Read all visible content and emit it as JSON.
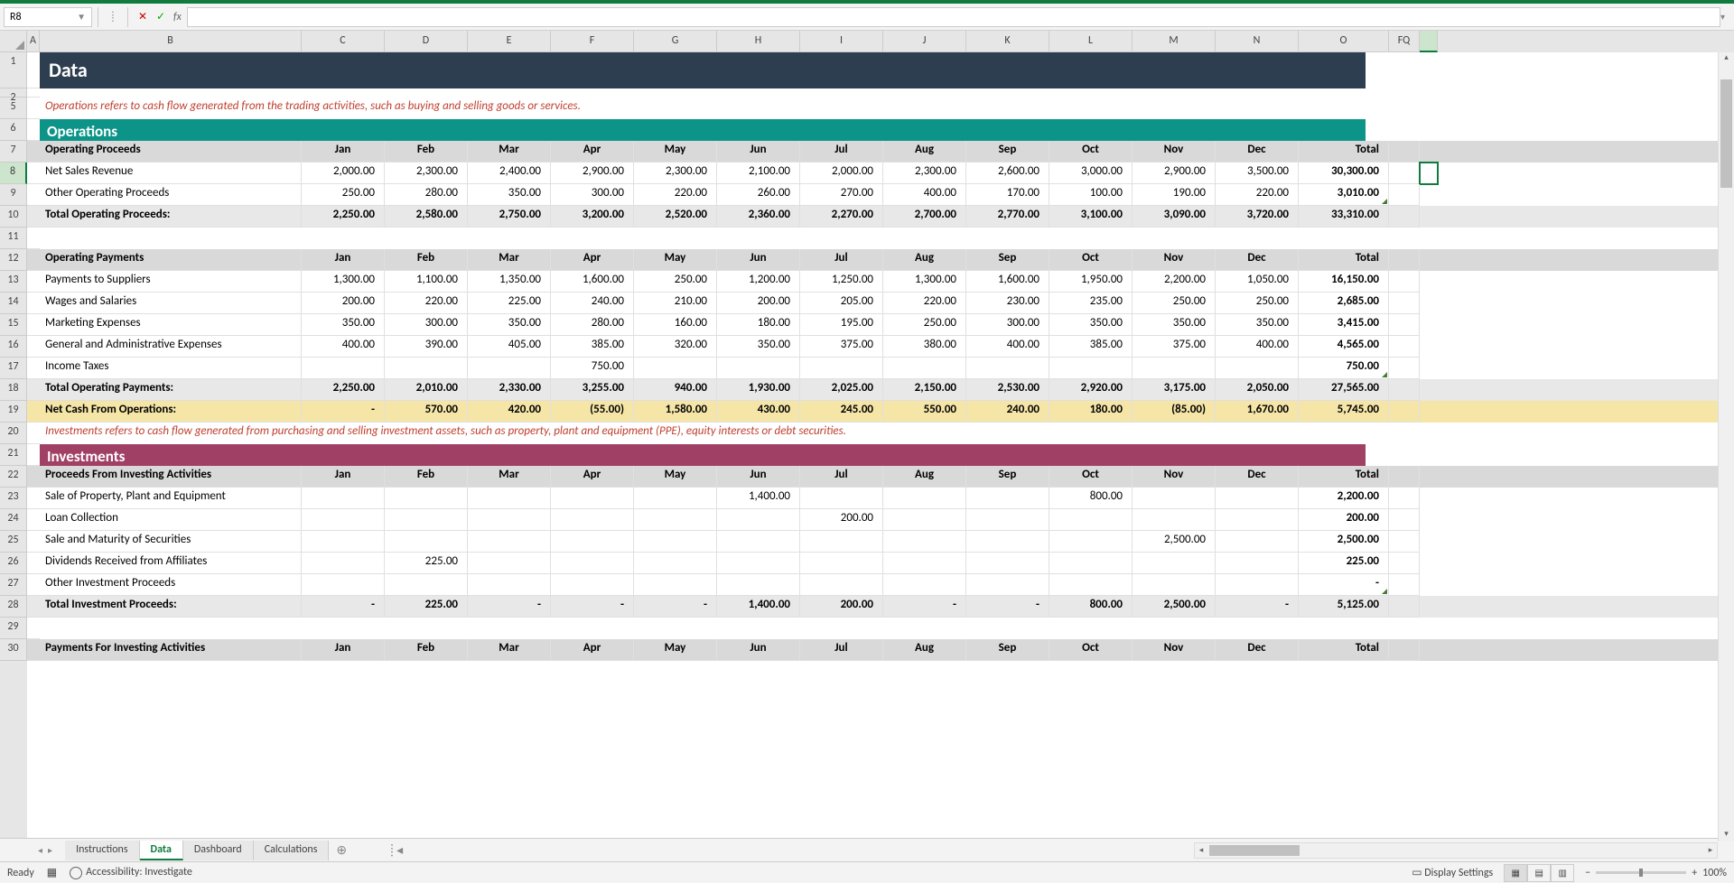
{
  "name_box": "R8",
  "title": "Data",
  "note_ops": "Operations refers to cash flow generated from the trading activities, such as buying and selling goods or services.",
  "note_inv": "Investments refers to cash flow generated from purchasing and selling investment assets, such as property, plant and equipment (PPE), equity interests or debt securities.",
  "section_ops": "Operations",
  "section_inv": "Investments",
  "months": [
    "Jan",
    "Feb",
    "Mar",
    "Apr",
    "May",
    "Jun",
    "Jul",
    "Aug",
    "Sep",
    "Oct",
    "Nov",
    "Dec",
    "Total"
  ],
  "cols": [
    "A",
    "B",
    "C",
    "D",
    "E",
    "F",
    "G",
    "H",
    "I",
    "J",
    "K",
    "L",
    "M",
    "N",
    "O",
    "FQ"
  ],
  "rownums": [
    1,
    2,
    5,
    6,
    7,
    8,
    9,
    10,
    11,
    12,
    13,
    14,
    15,
    16,
    17,
    18,
    19,
    20,
    21,
    22,
    23,
    24,
    25,
    26,
    27,
    28,
    29,
    30
  ],
  "hdr_op_proc": "Operating Proceeds",
  "hdr_op_pay": "Operating Payments",
  "hdr_inv_proc": "Proceeds From Investing Activities",
  "hdr_inv_pay": "Payments For Investing Activities",
  "row_nsr": {
    "label": "Net Sales Revenue",
    "d": [
      "2,000.00",
      "2,300.00",
      "2,400.00",
      "2,900.00",
      "2,300.00",
      "2,100.00",
      "2,000.00",
      "2,300.00",
      "2,600.00",
      "3,000.00",
      "2,900.00",
      "3,500.00",
      "30,300.00"
    ]
  },
  "row_oop": {
    "label": "Other Operating Proceeds",
    "d": [
      "250.00",
      "280.00",
      "350.00",
      "300.00",
      "220.00",
      "260.00",
      "270.00",
      "400.00",
      "170.00",
      "100.00",
      "190.00",
      "220.00",
      "3,010.00"
    ]
  },
  "row_top": {
    "label": "Total Operating Proceeds:",
    "d": [
      "2,250.00",
      "2,580.00",
      "2,750.00",
      "3,200.00",
      "2,520.00",
      "2,360.00",
      "2,270.00",
      "2,700.00",
      "2,770.00",
      "3,100.00",
      "3,090.00",
      "3,720.00",
      "33,310.00"
    ]
  },
  "row_pts": {
    "label": "Payments to Suppliers",
    "d": [
      "1,300.00",
      "1,100.00",
      "1,350.00",
      "1,600.00",
      "250.00",
      "1,200.00",
      "1,250.00",
      "1,300.00",
      "1,600.00",
      "1,950.00",
      "2,200.00",
      "1,050.00",
      "16,150.00"
    ]
  },
  "row_was": {
    "label": "Wages and Salaries",
    "d": [
      "200.00",
      "220.00",
      "225.00",
      "240.00",
      "210.00",
      "200.00",
      "205.00",
      "220.00",
      "230.00",
      "235.00",
      "250.00",
      "250.00",
      "2,685.00"
    ]
  },
  "row_me": {
    "label": "Marketing Expenses",
    "d": [
      "350.00",
      "300.00",
      "350.00",
      "280.00",
      "160.00",
      "180.00",
      "195.00",
      "250.00",
      "300.00",
      "350.00",
      "350.00",
      "350.00",
      "3,415.00"
    ]
  },
  "row_gae": {
    "label": "General and Administrative Expenses",
    "d": [
      "400.00",
      "390.00",
      "405.00",
      "385.00",
      "320.00",
      "350.00",
      "375.00",
      "380.00",
      "400.00",
      "385.00",
      "375.00",
      "400.00",
      "4,565.00"
    ]
  },
  "row_it": {
    "label": "Income Taxes",
    "d": [
      "",
      "",
      "",
      "750.00",
      "",
      "",
      "",
      "",
      "",
      "",
      "",
      "",
      "750.00"
    ]
  },
  "row_topay": {
    "label": "Total Operating Payments:",
    "d": [
      "2,250.00",
      "2,010.00",
      "2,330.00",
      "3,255.00",
      "940.00",
      "1,930.00",
      "2,025.00",
      "2,150.00",
      "2,530.00",
      "2,920.00",
      "3,175.00",
      "2,050.00",
      "27,565.00"
    ]
  },
  "row_nco": {
    "label": "Net Cash From Operations:",
    "d": [
      "-",
      "570.00",
      "420.00",
      "(55.00)",
      "1,580.00",
      "430.00",
      "245.00",
      "550.00",
      "240.00",
      "180.00",
      "(85.00)",
      "1,670.00",
      "5,745.00"
    ]
  },
  "row_sppe": {
    "label": "Sale of Property, Plant and Equipment",
    "d": [
      "",
      "",
      "",
      "",
      "",
      "1,400.00",
      "",
      "",
      "",
      "800.00",
      "",
      "",
      "2,200.00"
    ]
  },
  "row_lc": {
    "label": "Loan Collection",
    "d": [
      "",
      "",
      "",
      "",
      "",
      "",
      "200.00",
      "",
      "",
      "",
      "",
      "",
      "200.00"
    ]
  },
  "row_sms": {
    "label": "Sale and Maturity of Securities",
    "d": [
      "",
      "",
      "",
      "",
      "",
      "",
      "",
      "",
      "",
      "",
      "2,500.00",
      "",
      "2,500.00"
    ]
  },
  "row_dra": {
    "label": "Dividends Received from Affiliates",
    "d": [
      "",
      "225.00",
      "",
      "",
      "",
      "",
      "",
      "",
      "",
      "",
      "",
      "",
      "225.00"
    ]
  },
  "row_oip": {
    "label": "Other Investment Proceeds",
    "d": [
      "",
      "",
      "",
      "",
      "",
      "",
      "",
      "",
      "",
      "",
      "",
      "",
      "-"
    ]
  },
  "row_tip": {
    "label": "Total Investment Proceeds:",
    "d": [
      "-",
      "225.00",
      "-",
      "-",
      "-",
      "1,400.00",
      "200.00",
      "-",
      "-",
      "800.00",
      "2,500.00",
      "-",
      "5,125.00"
    ]
  },
  "tabs": [
    "Instructions",
    "Data",
    "Dashboard",
    "Calculations"
  ],
  "status_ready": "Ready",
  "status_acc": "Accessibility: Investigate",
  "status_disp": "Display Settings",
  "zoom": "100%"
}
